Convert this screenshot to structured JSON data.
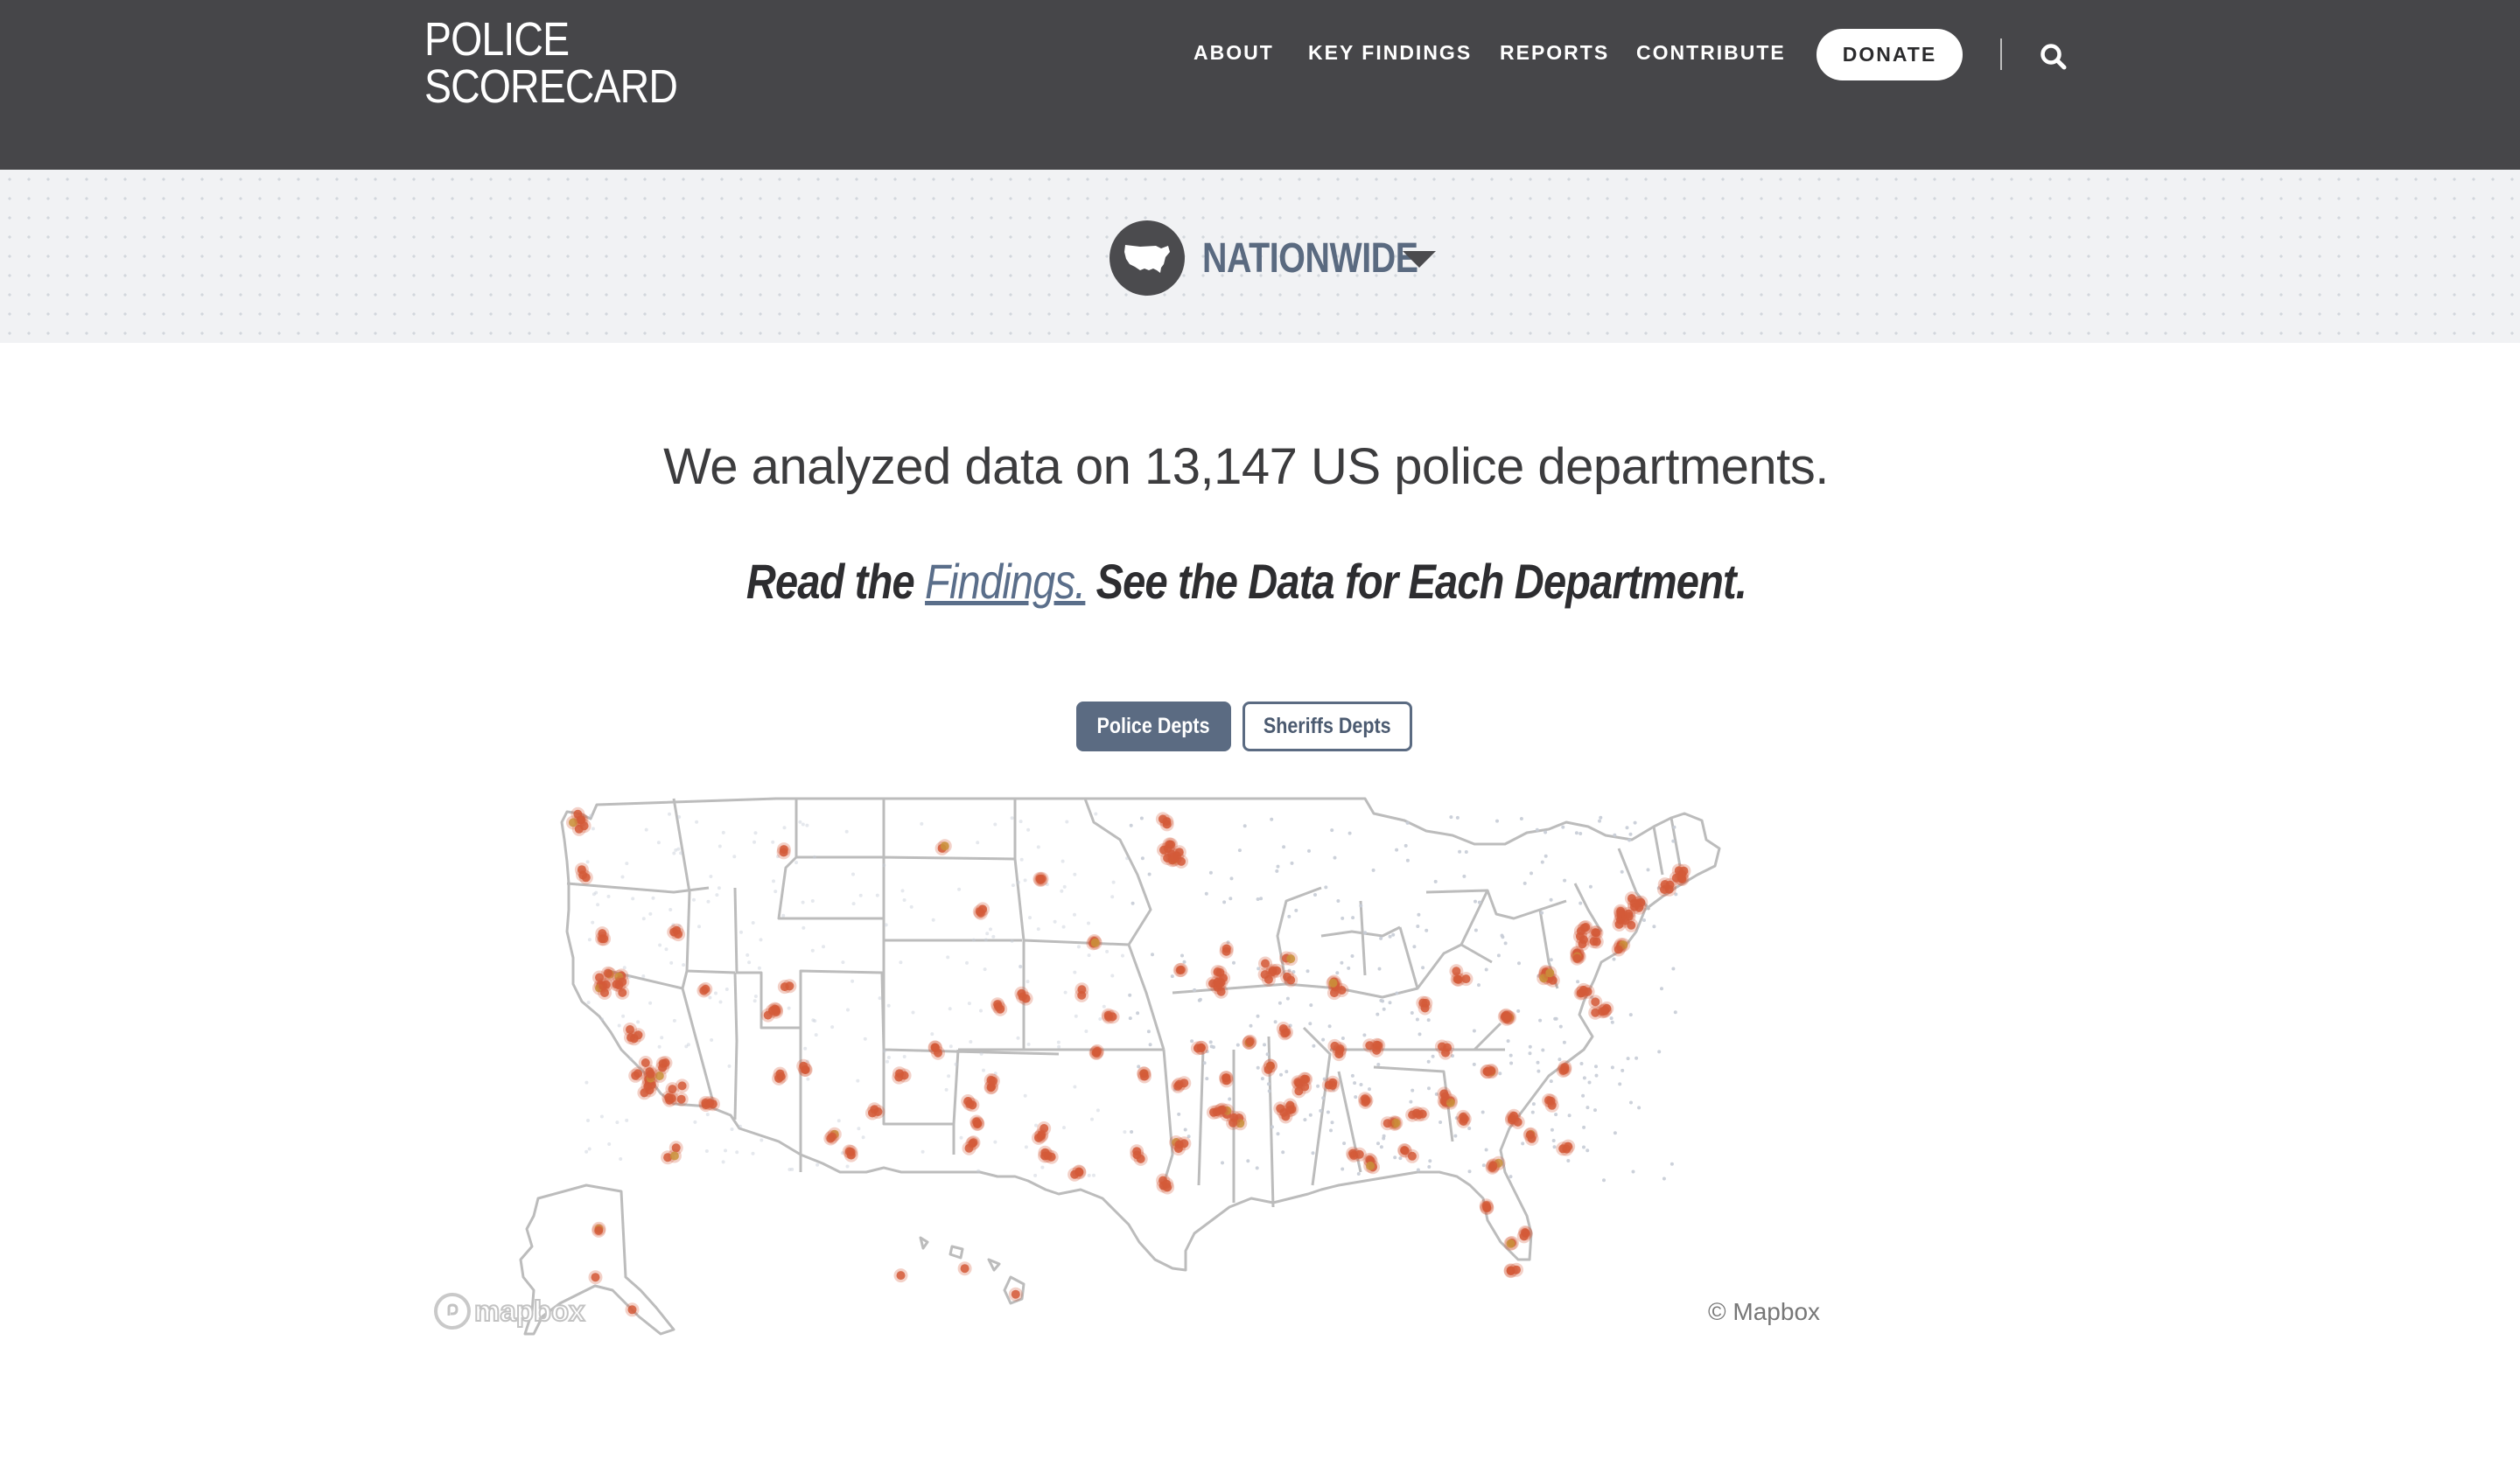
{
  "header": {
    "logo_line1": "POLICE",
    "logo_line2": "SCORECARD",
    "nav": [
      "ABOUT",
      "KEY FINDINGS",
      "REPORTS",
      "CONTRIBUTE"
    ],
    "donate_label": "DONATE"
  },
  "location": {
    "label": "NATIONWIDE"
  },
  "main": {
    "headline": "We analyzed data on 13,147 US police departments.",
    "sub_prefix": "Read the ",
    "sub_link": "Findings.",
    "sub_suffix": " See the Data for Each Department.",
    "toggle_active": "Police Depts",
    "toggle_inactive": "Sheriffs Depts"
  },
  "map": {
    "logo_text": "mapbox",
    "attribution": "© Mapbox"
  },
  "colors": {
    "header_bg": "#464649",
    "accent": "#5b6b82",
    "marker": "#d45a38",
    "marker_alt": "#c9923a",
    "state_border": "#bcbcbc"
  }
}
